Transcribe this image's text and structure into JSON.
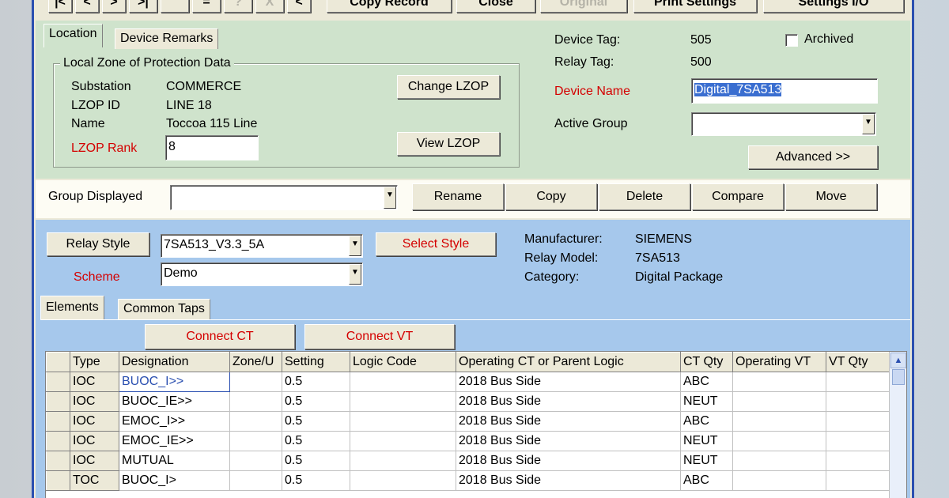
{
  "toolbar": {
    "nav_buttons": [
      "|<",
      "<",
      ">",
      ">|",
      "",
      "=",
      "?",
      "X",
      "<"
    ],
    "copy_record": "Copy Record",
    "close": "Close",
    "original": "Original",
    "print_settings": "Print Settings",
    "settings_io": "Settings I/O"
  },
  "tabs_top": {
    "location": "Location",
    "device_remarks": "Device Remarks"
  },
  "lzop": {
    "group_title": "Local Zone of Protection Data",
    "substation_label": "Substation",
    "substation_value": "COMMERCE",
    "lzop_id_label": "LZOP ID",
    "lzop_id_value": "LINE 18",
    "name_label": "Name",
    "name_value": "Toccoa 115 Line",
    "rank_label": "LZOP Rank",
    "rank_value": "8",
    "change_btn": "Change LZOP",
    "view_btn": "View LZOP"
  },
  "device": {
    "device_tag_label": "Device Tag:",
    "device_tag_value": "505",
    "archived_label": "Archived",
    "relay_tag_label": "Relay Tag:",
    "relay_tag_value": "500",
    "device_name_label": "Device Name",
    "device_name_value": "Digital_7SA513",
    "active_group_label": "Active Group",
    "active_group_value": "",
    "advanced_btn": "Advanced >>"
  },
  "group_bar": {
    "label": "Group Displayed",
    "value": "",
    "rename": "Rename",
    "copy": "Copy",
    "delete": "Delete",
    "compare": "Compare",
    "move": "Move"
  },
  "relay": {
    "relay_style_btn": "Relay Style",
    "relay_style_value": "7SA513_V3.3_5A",
    "select_style_btn": "Select Style",
    "scheme_label": "Scheme",
    "scheme_value": "Demo",
    "manufacturer_label": "Manufacturer:",
    "manufacturer_value": "SIEMENS",
    "model_label": "Relay Model:",
    "model_value": "7SA513",
    "category_label": "Category:",
    "category_value": "Digital Package"
  },
  "tabs_bottom": {
    "elements": "Elements",
    "common_taps": "Common Taps"
  },
  "connect": {
    "ct": "Connect CT",
    "vt": "Connect VT"
  },
  "grid": {
    "headers": [
      "Type",
      "Designation",
      "Zone/U",
      "Setting",
      "Logic Code",
      "Operating CT or Parent Logic",
      "CT Qty",
      "Operating VT",
      "VT Qty"
    ],
    "rows": [
      [
        "IOC",
        "BUOC_I>>",
        "",
        "0.5",
        "",
        "2018  Bus Side",
        "ABC",
        "",
        ""
      ],
      [
        "IOC",
        "BUOC_IE>>",
        "",
        "0.5",
        "",
        "2018  Bus Side",
        "NEUT",
        "",
        ""
      ],
      [
        "IOC",
        "EMOC_I>>",
        "",
        "0.5",
        "",
        "2018  Bus Side",
        "ABC",
        "",
        ""
      ],
      [
        "IOC",
        "EMOC_IE>>",
        "",
        "0.5",
        "",
        "2018  Bus Side",
        "NEUT",
        "",
        ""
      ],
      [
        "IOC",
        "MUTUAL",
        "",
        "0.5",
        "",
        "2018  Bus Side",
        "NEUT",
        "",
        ""
      ],
      [
        "TOC",
        "BUOC_I>",
        "",
        "0.5",
        "",
        "2018  Bus Side",
        "ABC",
        "",
        ""
      ]
    ]
  },
  "colors": {
    "top_panel": "#cfe3cc",
    "bottom_panel": "#a6c8ec",
    "accent_red": "#d40000",
    "frame_blue": "#2a4fb0"
  }
}
